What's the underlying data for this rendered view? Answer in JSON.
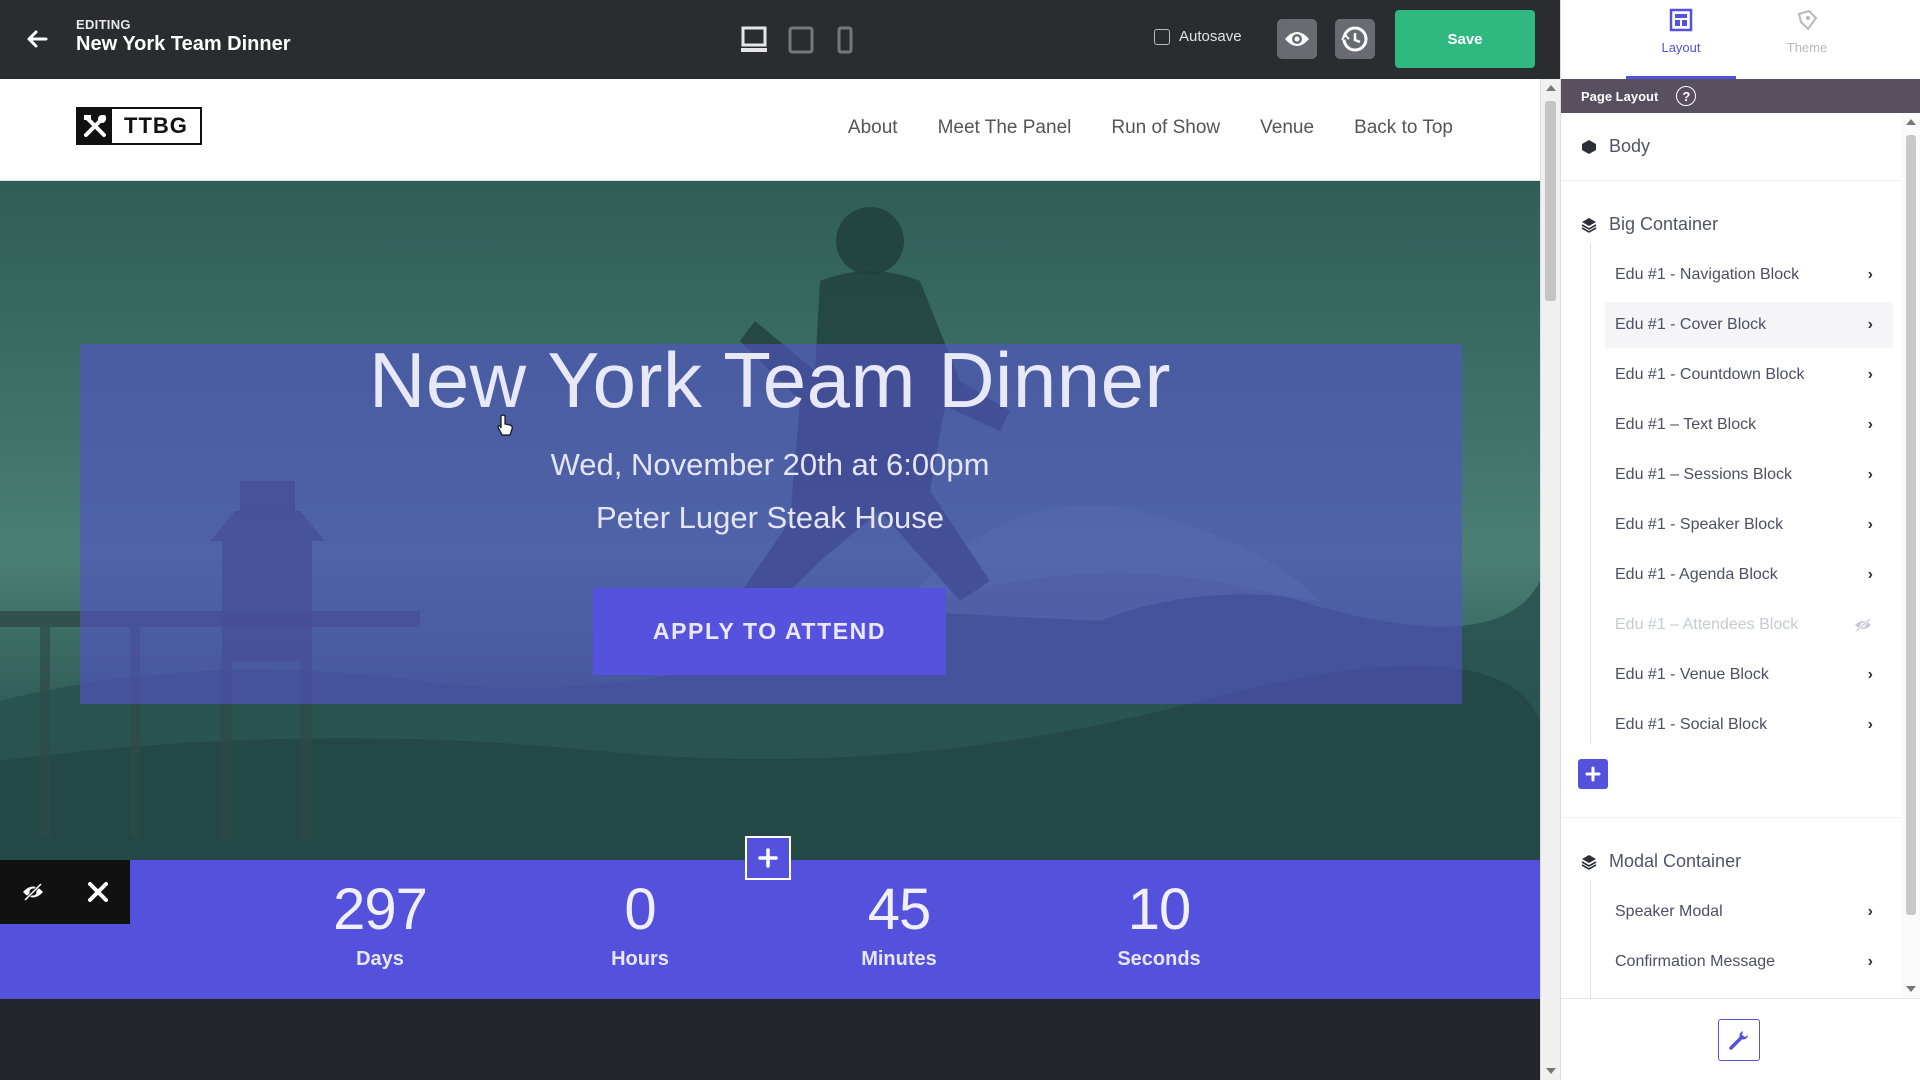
{
  "topbar": {
    "editing_label": "EDITING",
    "page_title": "New York Team Dinner",
    "autosave_label": "Autosave",
    "autosave_checked": false,
    "save_label": "Save"
  },
  "site": {
    "logo_text": "TTBG",
    "nav": [
      "About",
      "Meet The Panel",
      "Run of Show",
      "Venue",
      "Back to Top"
    ]
  },
  "cover": {
    "title": "New York Team Dinner",
    "date": "Wed, November 20th at 6:00pm",
    "venue": "Peter Luger Steak House",
    "cta": "APPLY TO ATTEND"
  },
  "countdown": [
    {
      "value": "297",
      "label": "Days"
    },
    {
      "value": "0",
      "label": "Hours"
    },
    {
      "value": "45",
      "label": "Minutes"
    },
    {
      "value": "10",
      "label": "Seconds"
    }
  ],
  "panel": {
    "tabs": [
      {
        "label": "Layout",
        "icon": "layout-icon",
        "active": true
      },
      {
        "label": "Theme",
        "icon": "theme-icon",
        "active": false
      }
    ],
    "header": "Page Layout",
    "body_label": "Body",
    "big_container": {
      "label": "Big Container",
      "items": [
        {
          "label": "Edu #1 - Navigation Block",
          "hidden": false
        },
        {
          "label": "Edu #1 - Cover Block",
          "hidden": false
        },
        {
          "label": "Edu #1 - Countdown Block",
          "hidden": false
        },
        {
          "label": "Edu #1 – Text Block",
          "hidden": false
        },
        {
          "label": "Edu #1 – Sessions Block",
          "hidden": false
        },
        {
          "label": "Edu #1 - Speaker Block",
          "hidden": false
        },
        {
          "label": "Edu #1 - Agenda Block",
          "hidden": false
        },
        {
          "label": "Edu #1 – Attendees Block",
          "hidden": true
        },
        {
          "label": "Edu #1 - Venue Block",
          "hidden": false
        },
        {
          "label": "Edu #1 - Social Block",
          "hidden": false
        }
      ]
    },
    "modal_container": {
      "label": "Modal Container",
      "items": [
        {
          "label": "Speaker Modal",
          "hidden": false
        },
        {
          "label": "Confirmation Message",
          "hidden": false
        }
      ]
    }
  },
  "colors": {
    "accent": "#5452dc",
    "save_green": "#2fb980",
    "topbar": "#2b2c30",
    "panel_header": "#58505f"
  }
}
